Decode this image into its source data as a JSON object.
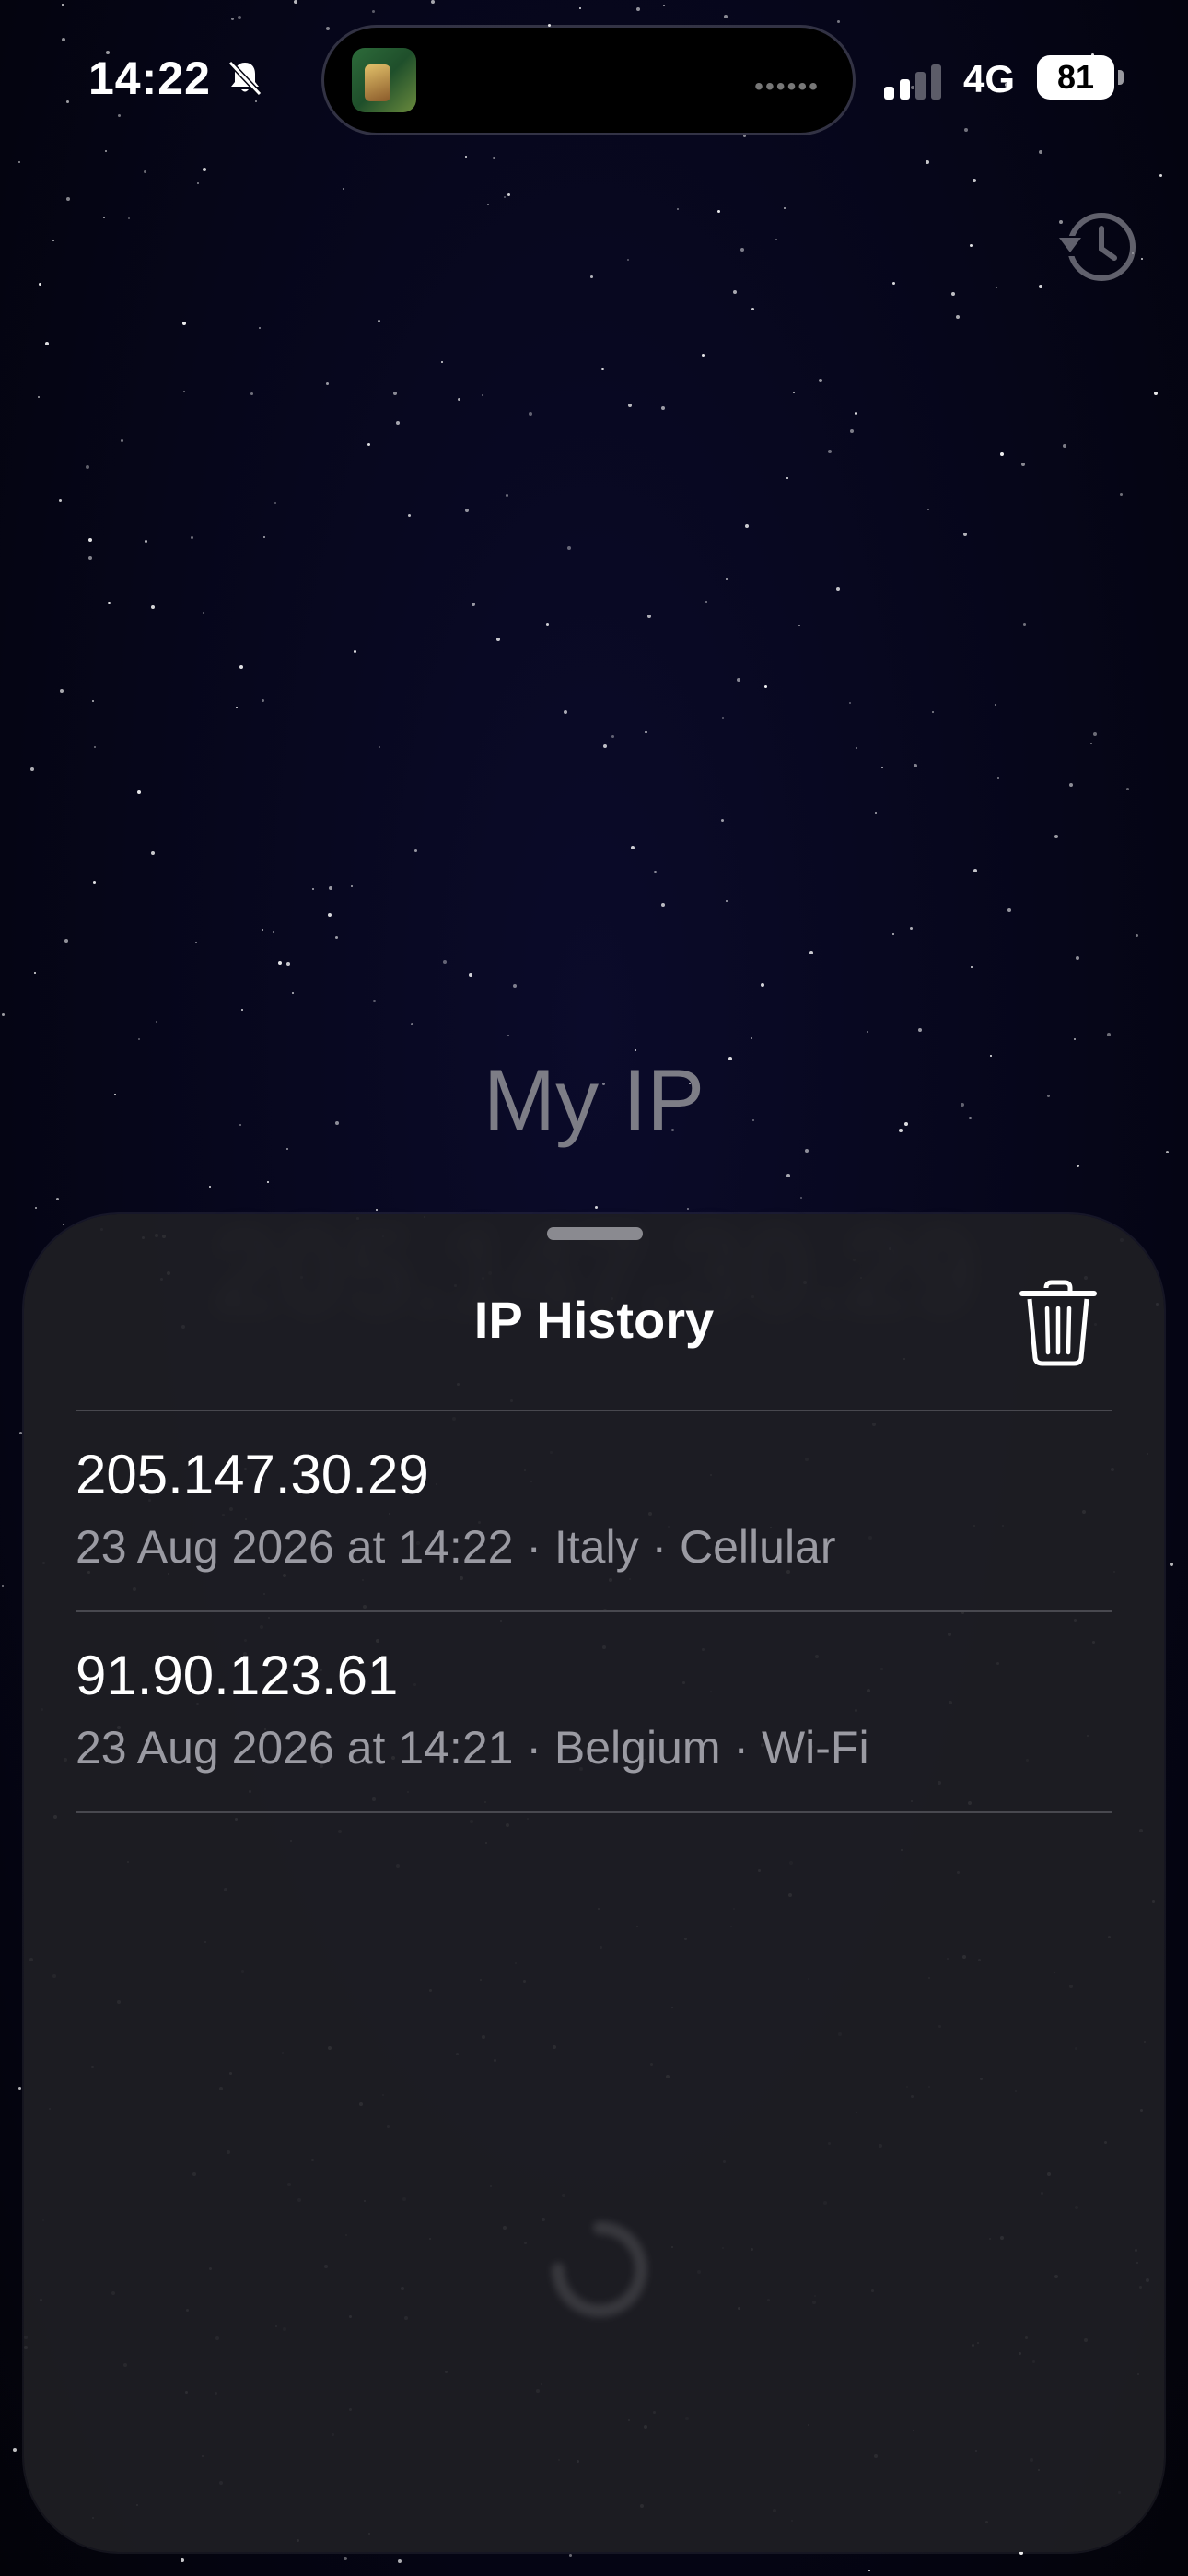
{
  "status_bar": {
    "time": "14:22",
    "network": "4G",
    "battery": "81",
    "icons": [
      "bell-slash-icon",
      "signal-icon"
    ]
  },
  "app": {
    "title": "My IP"
  },
  "sheet": {
    "title": "IP History",
    "entries": [
      {
        "ip": "205.147.30.29",
        "meta": "23 Aug 2026 at 14:22 · Italy · Cellular"
      },
      {
        "ip": "91.90.123.61",
        "meta": "23 Aug 2026 at 14:21 · Belgium · Wi-Fi"
      }
    ]
  },
  "colors": {
    "sheet_background": "#1e1e23",
    "secondary_text": "#9a9aa2",
    "divider": "#48484f"
  }
}
